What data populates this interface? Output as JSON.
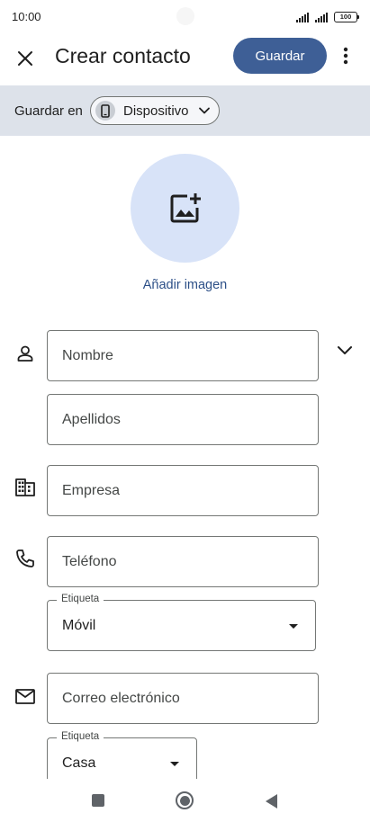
{
  "status_bar": {
    "time": "10:00",
    "battery": "100"
  },
  "app_bar": {
    "title": "Crear contacto",
    "save_label": "Guardar"
  },
  "save_in": {
    "label": "Guardar en",
    "account": "Dispositivo"
  },
  "photo": {
    "add_image_label": "Añadir imagen"
  },
  "fields": {
    "first_name": "Nombre",
    "last_name": "Apellidos",
    "company": "Empresa",
    "phone": "Teléfono",
    "phone_label": {
      "legend": "Etiqueta",
      "value": "Móvil"
    },
    "email": "Correo electrónico",
    "email_label": {
      "legend": "Etiqueta",
      "value": "Casa"
    }
  },
  "colors": {
    "accent": "#3e5f96",
    "band": "#dde2ea",
    "photo_bg": "#d8e3f8"
  },
  "icons": [
    "close-icon",
    "more-vert-icon",
    "phone-device-icon",
    "chevron-down-icon",
    "add-photo-icon",
    "person-icon",
    "business-icon",
    "phone-icon",
    "mail-icon"
  ]
}
